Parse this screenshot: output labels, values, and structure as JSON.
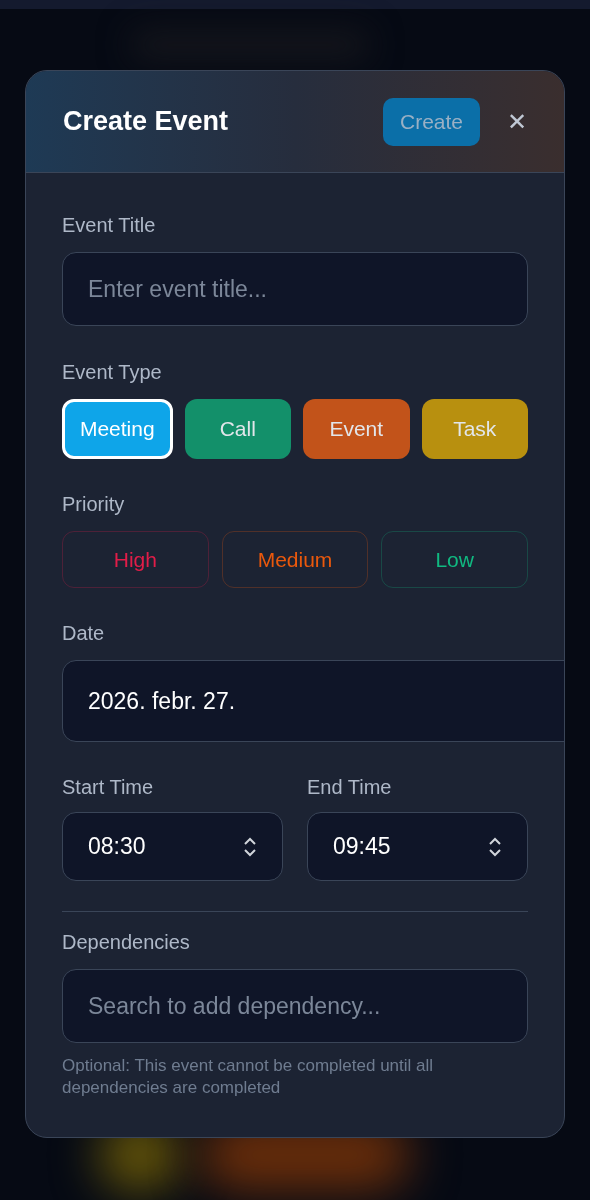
{
  "modal": {
    "title": "Create Event",
    "create_button": "Create",
    "close_button": "✕"
  },
  "event_title": {
    "label": "Event Title",
    "placeholder": "Enter event title..."
  },
  "event_type": {
    "label": "Event Type",
    "options": [
      {
        "label": "Meeting",
        "color": "#0ea5e9",
        "selected": true
      },
      {
        "label": "Call",
        "color": "#13906a",
        "selected": false
      },
      {
        "label": "Event",
        "color": "#c2531a",
        "selected": false
      },
      {
        "label": "Task",
        "color": "#b8900f",
        "selected": false
      }
    ]
  },
  "priority": {
    "label": "Priority",
    "options": [
      {
        "label": "High",
        "color": "#e11d48",
        "selected": false
      },
      {
        "label": "Medium",
        "color": "#ea580c",
        "selected": false
      },
      {
        "label": "Low",
        "color": "#10b981",
        "selected": false
      }
    ]
  },
  "date": {
    "label": "Date",
    "value": "2026. febr. 27."
  },
  "start_time": {
    "label": "Start Time",
    "value": "08:30"
  },
  "end_time": {
    "label": "End Time",
    "value": "09:45"
  },
  "dependencies": {
    "label": "Dependencies",
    "placeholder": "Search to add dependency...",
    "help": "Optional: This event cannot be completed until all dependencies are completed"
  }
}
